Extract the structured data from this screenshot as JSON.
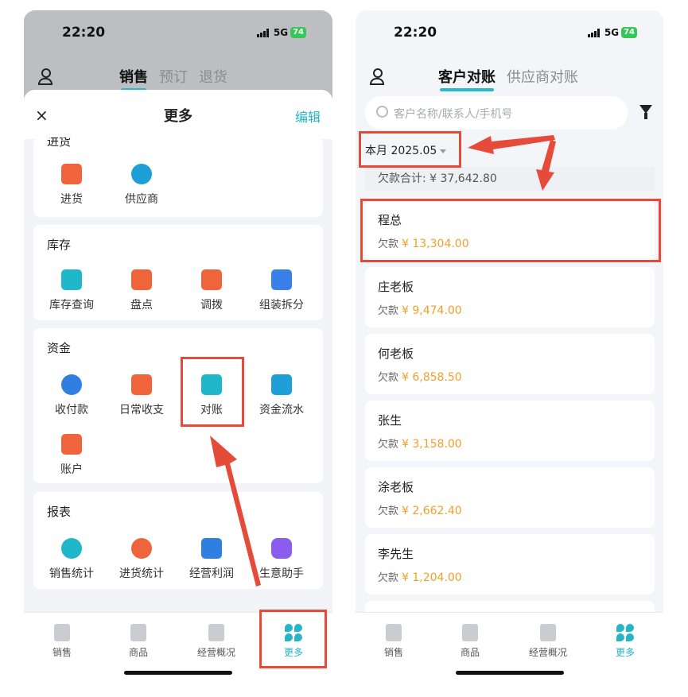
{
  "left": {
    "status": {
      "time": "22:20",
      "network": "5G",
      "battery": "74"
    },
    "top_tabs": [
      "销售",
      "预订",
      "退货"
    ],
    "sheet": {
      "close": "×",
      "title": "更多",
      "edit": "编辑"
    },
    "sections": [
      {
        "title": "进货",
        "items": [
          {
            "label": "进货",
            "icon": "cart-icon",
            "color": "#f0643c"
          },
          {
            "label": "供应商",
            "icon": "supplier-icon",
            "color": "#1f9fd8"
          }
        ]
      },
      {
        "title": "库存",
        "items": [
          {
            "label": "库存查询",
            "icon": "inventory-search-icon",
            "color": "#1fb7c9"
          },
          {
            "label": "盘点",
            "icon": "stocktake-icon",
            "color": "#f0643c"
          },
          {
            "label": "调拨",
            "icon": "transfer-icon",
            "color": "#f0643c"
          },
          {
            "label": "组装拆分",
            "icon": "assembly-icon",
            "color": "#3b7fe8"
          }
        ]
      },
      {
        "title": "资金",
        "items": [
          {
            "label": "收付款",
            "icon": "payment-icon",
            "color": "#2f7fe0"
          },
          {
            "label": "日常收支",
            "icon": "daily-expense-icon",
            "color": "#f0643c"
          },
          {
            "label": "对账",
            "icon": "reconcile-icon",
            "color": "#1fb7c9"
          },
          {
            "label": "资金流水",
            "icon": "cashflow-icon",
            "color": "#1f9fd8"
          },
          {
            "label": "账户",
            "icon": "wallet-icon",
            "color": "#f0643c"
          }
        ]
      },
      {
        "title": "报表",
        "items": [
          {
            "label": "销售统计",
            "icon": "sales-stats-icon",
            "color": "#1fb7c9"
          },
          {
            "label": "进货统计",
            "icon": "purchase-stats-icon",
            "color": "#f0643c"
          },
          {
            "label": "经营利润",
            "icon": "profit-chart-icon",
            "color": "#2f7fe0"
          },
          {
            "label": "生意助手",
            "icon": "ai-assistant-icon",
            "color": "#8a5cf0"
          }
        ]
      }
    ],
    "tabbar": [
      {
        "label": "销售",
        "icon": "sales-icon"
      },
      {
        "label": "商品",
        "icon": "goods-icon"
      },
      {
        "label": "经营概况",
        "icon": "overview-icon"
      },
      {
        "label": "更多",
        "icon": "more-icon"
      }
    ]
  },
  "right": {
    "status": {
      "time": "22:20",
      "network": "5G",
      "battery": "74"
    },
    "top_tabs": [
      "客户对账",
      "供应商对账"
    ],
    "search_placeholder": "客户名称/联系人/手机号",
    "month_filter": "本月 2025.05",
    "total": "欠款合计: ¥ 37,642.80",
    "debt_label": "欠款",
    "customers": [
      {
        "name": "程总",
        "amount": "¥ 13,304.00"
      },
      {
        "name": "庄老板",
        "amount": "¥ 9,474.00"
      },
      {
        "name": "何老板",
        "amount": "¥ 6,858.50"
      },
      {
        "name": "张生",
        "amount": "¥ 3,158.00"
      },
      {
        "name": "涂老板",
        "amount": "¥ 2,662.40"
      },
      {
        "name": "李先生",
        "amount": "¥ 1,204.00"
      }
    ],
    "tabbar": [
      {
        "label": "销售"
      },
      {
        "label": "商品"
      },
      {
        "label": "经营概况"
      },
      {
        "label": "更多"
      }
    ]
  },
  "colors": {
    "accent": "#26b5c7",
    "highlight": "#e64b3a",
    "amount": "#f0a02a"
  }
}
